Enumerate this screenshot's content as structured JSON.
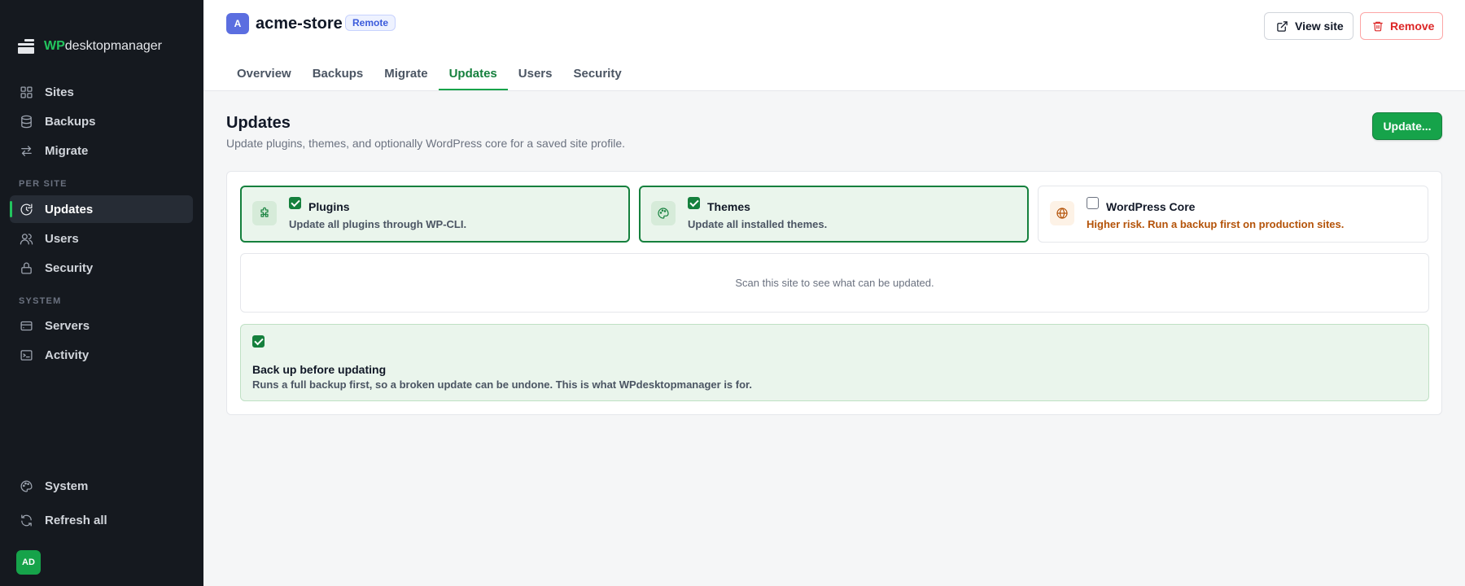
{
  "sidebar": {
    "brand_wp": "WP",
    "brand_rest": "desktopmanager",
    "items": [
      {
        "label": "Sites",
        "icon": "grid-icon"
      },
      {
        "label": "Backups",
        "icon": "database-icon"
      },
      {
        "label": "Migrate",
        "icon": "swap-icon"
      },
      {
        "label": "Updates",
        "icon": "refresh-icon"
      },
      {
        "label": "Users",
        "icon": "users-icon"
      },
      {
        "label": "Security",
        "icon": "lock-icon"
      },
      {
        "label": "Servers",
        "icon": "server-icon"
      },
      {
        "label": "Activity",
        "icon": "terminal-icon"
      },
      {
        "label": "System",
        "icon": "palette-icon"
      },
      {
        "label": "Refresh all",
        "icon": "refresh-all-icon"
      }
    ],
    "section_per_site": "PER SITE",
    "section_system": "SYSTEM",
    "active_item": "Updates",
    "user_initials": "AD"
  },
  "header": {
    "site_initial": "A",
    "site_name": "acme-store",
    "site_type": "Remote",
    "view_site_label": "View site",
    "remove_label": "Remove",
    "tabs": [
      {
        "label": "Overview"
      },
      {
        "label": "Backups"
      },
      {
        "label": "Migrate"
      },
      {
        "label": "Updates"
      },
      {
        "label": "Users"
      },
      {
        "label": "Security"
      }
    ],
    "active_tab": "Updates"
  },
  "main": {
    "title": "Updates",
    "subtitle": "Update plugins, themes, and optionally WordPress core for a saved site profile.",
    "update_button": "Update...",
    "options": [
      {
        "title": "Plugins",
        "desc": "Update all plugins through WP-CLI.",
        "checked": true,
        "icon": "puzzle-icon"
      },
      {
        "title": "Themes",
        "desc": "Update all installed themes.",
        "checked": true,
        "icon": "palette-icon"
      },
      {
        "title": "WordPress Core",
        "desc": "Higher risk. Run a backup first on production sites.",
        "checked": false,
        "icon": "globe-icon"
      }
    ],
    "scan_message": "Scan this site to see what can be updated.",
    "backup": {
      "checked": true,
      "title": "Back up before updating",
      "desc": "Runs a full backup first, so a broken update can be undone. This is what WPdesktopmanager is for."
    }
  },
  "colors": {
    "accent": "#16a34a",
    "sidebar_bg": "#15191f",
    "danger": "#dc2626",
    "warning": "#b45309"
  }
}
